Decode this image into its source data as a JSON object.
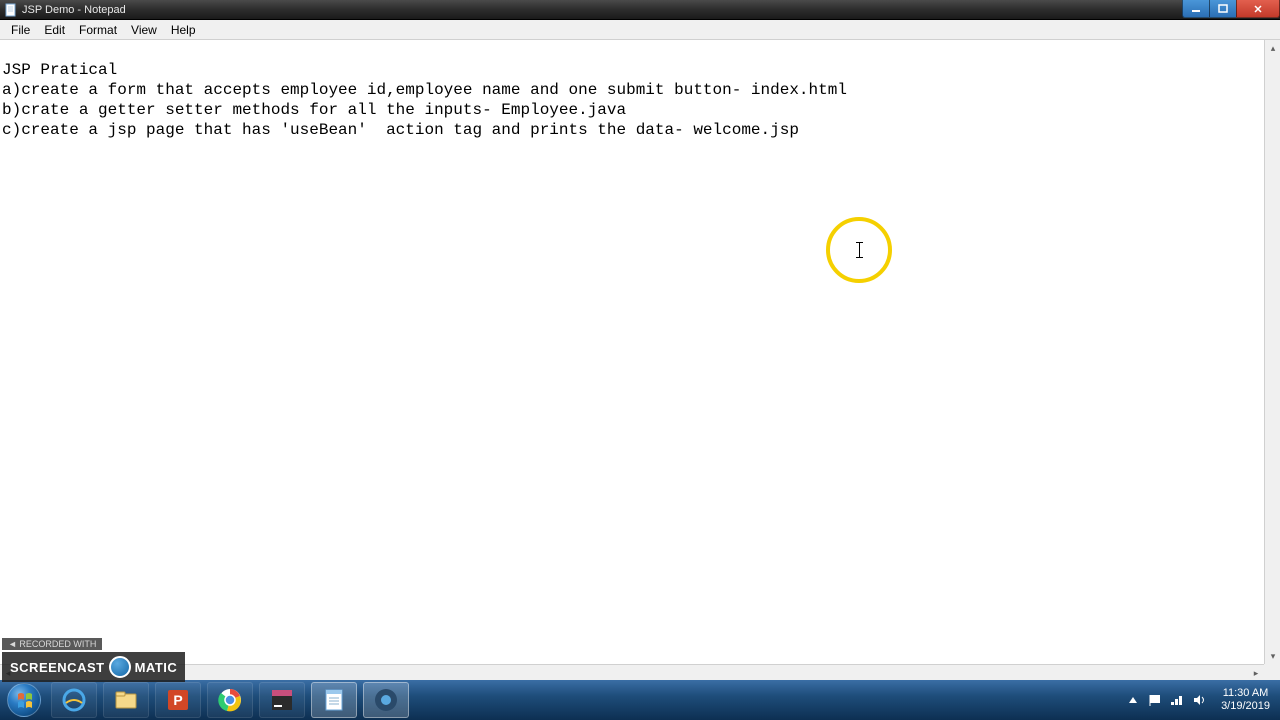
{
  "window": {
    "title": "JSP Demo - Notepad"
  },
  "menu": {
    "file": "File",
    "edit": "Edit",
    "format": "Format",
    "view": "View",
    "help": "Help"
  },
  "editor": {
    "content": "JSP Pratical\na)create a form that accepts employee id,employee name and one submit button- index.html\nb)crate a getter setter methods for all the inputs- Employee.java\nc)create a jsp page that has 'useBean'  action tag and prints the data- welcome.jsp"
  },
  "tray": {
    "time": "11:30 AM",
    "date": "3/19/2019"
  },
  "watermark": {
    "tab": "◄ RECORDED WITH",
    "brand1": "SCREENCAST",
    "brand2": "MATIC"
  }
}
